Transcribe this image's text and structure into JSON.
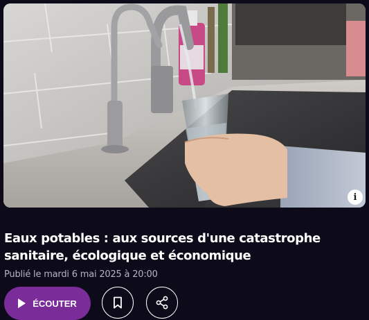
{
  "article": {
    "title": "Eaux potables : aux sources d'une catastrophe sanitaire, écologique et économique",
    "published": "Publié le mardi 6 mai 2025 à 20:00"
  },
  "hero": {
    "info_glyph": "i",
    "icon": "info-icon"
  },
  "actions": {
    "listen_label": "ÉCOUTER",
    "listen_icon": "play-icon",
    "bookmark_icon": "bookmark-icon",
    "share_icon": "share-icon"
  },
  "colors": {
    "background": "#0d0b1a",
    "accent": "#7a2c99",
    "muted_text": "#b6b3c4"
  }
}
